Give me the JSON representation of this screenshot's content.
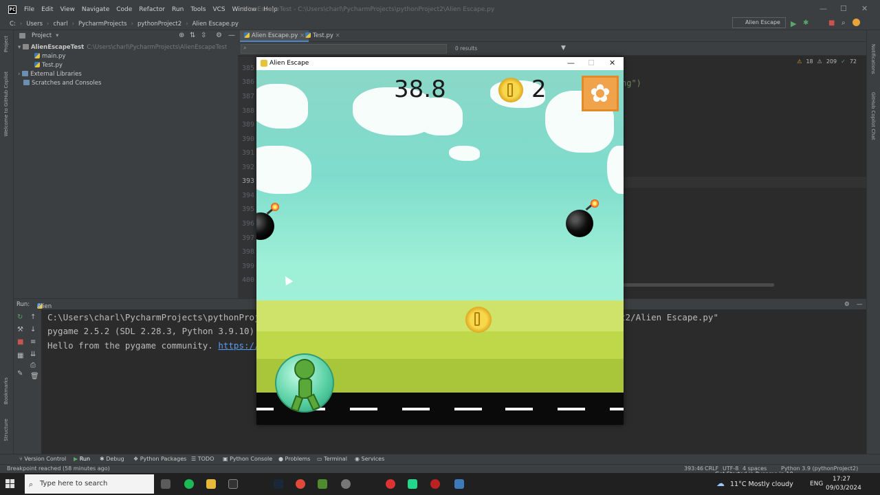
{
  "menu": {
    "items": [
      "File",
      "Edit",
      "View",
      "Navigate",
      "Code",
      "Refactor",
      "Run",
      "Tools",
      "VCS",
      "Window",
      "Help"
    ],
    "window_title": "AlienEscapeTest - C:\\Users\\charl\\PycharmProjects\\pythonProject2\\Alien Escape.py"
  },
  "breadcrumbs": [
    "C:",
    "Users",
    "charl",
    "PycharmProjects",
    "pythonProject2",
    "Alien Escape.py"
  ],
  "run_config": "Alien Escape",
  "project": {
    "header": "Project",
    "root": "AlienEscapeTest",
    "root_path": "C:\\Users\\charl\\PycharmProjects\\AlienEscapeTest",
    "files": [
      "main.py",
      "Test.py"
    ],
    "external": "External Libraries",
    "scratches": "Scratches and Consoles"
  },
  "editor": {
    "tabs": [
      "Alien Escape.py",
      "Test.py"
    ],
    "search_results": "0 results",
    "line_numbers": [
      "385",
      "386",
      "387",
      "388",
      "389",
      "390",
      "391",
      "392",
      "393",
      "394",
      "395",
      "396",
      "397",
      "398",
      "399",
      "400"
    ],
    "current_line": "393",
    "code_fragment": "ng\")",
    "inspections": {
      "warnings": "18",
      "weak": "209",
      "typos": "72"
    }
  },
  "run": {
    "label": "Run:",
    "config": "Alien Escape",
    "lines": [
      "C:\\Users\\charl\\PycharmProjects\\pythonProje",
      "pygame 2.5.2 (SDL 2.28.3, Python 3.9.10)",
      "Hello from the pygame community. "
    ],
    "link_text": "https://",
    "line1_tail": "t2/Alien Escape.py\""
  },
  "tool_tabs": [
    "Version Control",
    "Run",
    "Debug",
    "Python Packages",
    "TODO",
    "Python Console",
    "Problems",
    "Terminal",
    "Services"
  ],
  "status": {
    "message": "Breakpoint reached (58 minutes ago)",
    "position": "393:46",
    "line_sep": "CRLF",
    "encoding": "UTF-8",
    "indent": "4 spaces",
    "interpreter": "Python 3.9 (pythonProject2)",
    "extra": "Get Started in Pygame in 10"
  },
  "game": {
    "title": "Alien Escape",
    "score": "38.8",
    "coins": "2"
  },
  "taskbar": {
    "search_placeholder": "Type here to search",
    "weather": "11°C  Mostly cloudy",
    "lang": "ENG",
    "time": "17:27",
    "date": "09/03/2024"
  },
  "side_labels": {
    "left_top": "Project",
    "left_mid": "Welcome to GitHub Copilot",
    "left_bookmarks": "Bookmarks",
    "left_structure": "Structure",
    "right_notifications": "Notifications",
    "right_copilot": "GitHub Copilot Chat"
  }
}
